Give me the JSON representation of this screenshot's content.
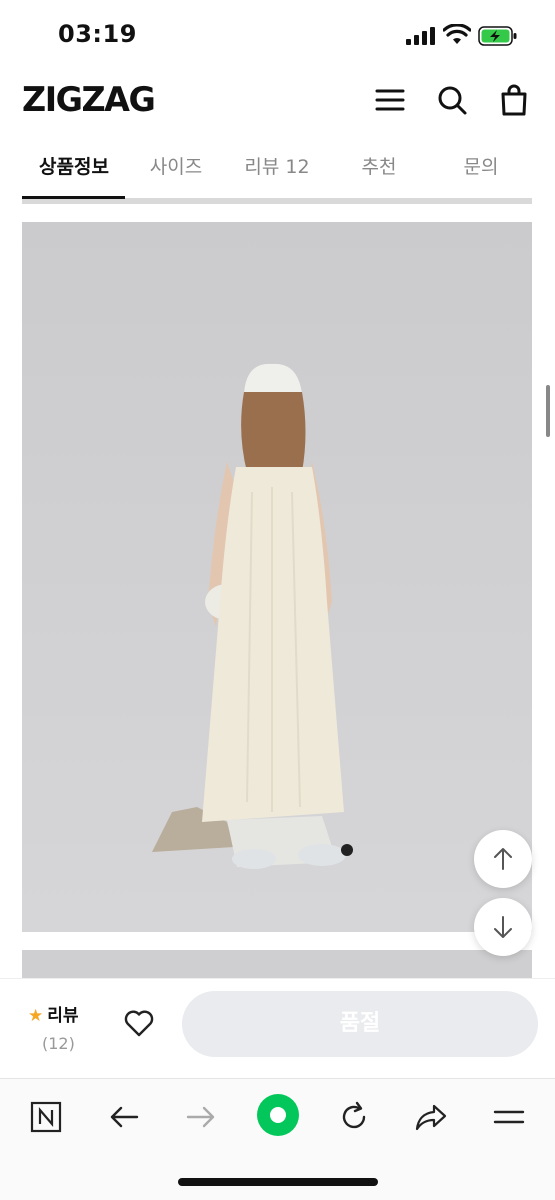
{
  "status_bar": {
    "time": "03:19",
    "icons": [
      "signal-icon",
      "wifi-icon",
      "battery-charging-icon"
    ],
    "battery_color": "#35c94a"
  },
  "header": {
    "logo": "ZIGZAG",
    "icons": [
      "menu-icon",
      "search-icon",
      "shopping-bag-icon"
    ]
  },
  "tabs": [
    {
      "label": "상품정보",
      "active": true
    },
    {
      "label": "사이즈",
      "active": false
    },
    {
      "label": "리뷰 12",
      "active": false
    },
    {
      "label": "추천",
      "active": false
    },
    {
      "label": "문의",
      "active": false
    }
  ],
  "floating_buttons": [
    "arrow-up-icon",
    "arrow-down-icon"
  ],
  "purchase_bar": {
    "review_label": "리뷰",
    "review_count": "(12)",
    "star_color": "#f5a623",
    "buy_button_label": "품절",
    "buy_button_color": "#e9ebee"
  },
  "browser_toolbar": {
    "icons": [
      "naver-n-icon",
      "back-arrow-icon",
      "forward-arrow-icon",
      "green-dot-icon",
      "reload-icon",
      "share-icon",
      "menu-lines-icon"
    ],
    "accent_color": "#03c75a"
  }
}
